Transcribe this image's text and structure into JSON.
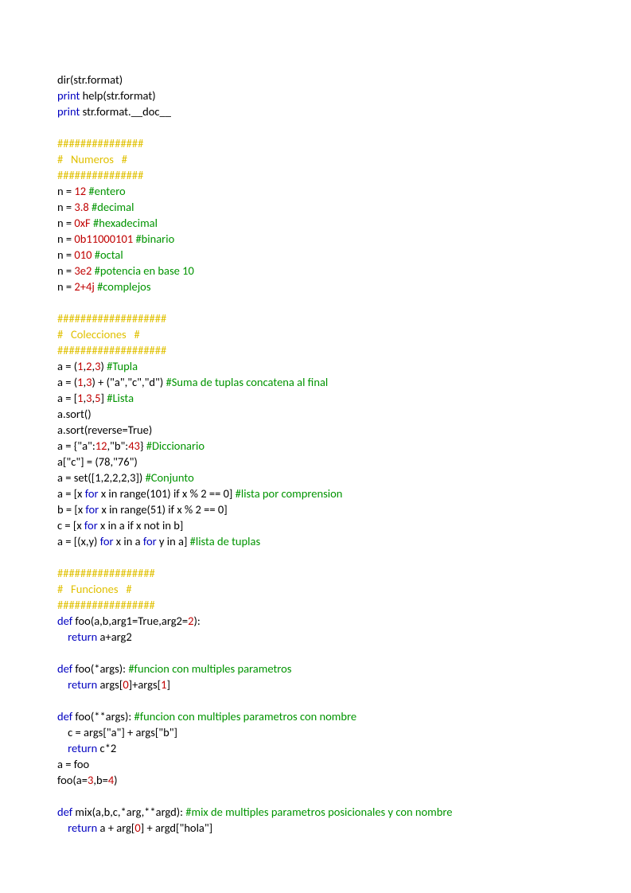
{
  "lines": [
    [
      {
        "c": "txt",
        "t": "dir(str.format)"
      }
    ],
    [
      {
        "c": "kw",
        "t": "print"
      },
      {
        "c": "txt",
        "t": " help(str.format)"
      }
    ],
    [
      {
        "c": "kw",
        "t": "print"
      },
      {
        "c": "txt",
        "t": " str.format.__doc__"
      }
    ],
    [
      {
        "c": "txt",
        "t": ""
      }
    ],
    [
      {
        "c": "hash",
        "t": "###############"
      }
    ],
    [
      {
        "c": "hash",
        "t": "#   Numeros   #"
      }
    ],
    [
      {
        "c": "hash",
        "t": "###############"
      }
    ],
    [
      {
        "c": "txt",
        "t": "n = "
      },
      {
        "c": "num",
        "t": "12"
      },
      {
        "c": "txt",
        "t": " "
      },
      {
        "c": "cmt",
        "t": "#entero"
      }
    ],
    [
      {
        "c": "txt",
        "t": "n = "
      },
      {
        "c": "num",
        "t": "3.8"
      },
      {
        "c": "txt",
        "t": " "
      },
      {
        "c": "cmt",
        "t": "#decimal"
      }
    ],
    [
      {
        "c": "txt",
        "t": "n = "
      },
      {
        "c": "num",
        "t": "0xF"
      },
      {
        "c": "txt",
        "t": " "
      },
      {
        "c": "cmt",
        "t": "#hexadecimal"
      }
    ],
    [
      {
        "c": "txt",
        "t": "n = "
      },
      {
        "c": "num",
        "t": "0b11000101"
      },
      {
        "c": "txt",
        "t": " "
      },
      {
        "c": "cmt",
        "t": "#binario"
      }
    ],
    [
      {
        "c": "txt",
        "t": "n = "
      },
      {
        "c": "num",
        "t": "010"
      },
      {
        "c": "txt",
        "t": " "
      },
      {
        "c": "cmt",
        "t": "#octal"
      }
    ],
    [
      {
        "c": "txt",
        "t": "n = "
      },
      {
        "c": "num",
        "t": "3e2"
      },
      {
        "c": "txt",
        "t": " "
      },
      {
        "c": "cmt",
        "t": "#potencia en base 10"
      }
    ],
    [
      {
        "c": "txt",
        "t": "n = "
      },
      {
        "c": "num",
        "t": "2+4j"
      },
      {
        "c": "txt",
        "t": " "
      },
      {
        "c": "cmt",
        "t": "#complejos"
      }
    ],
    [
      {
        "c": "txt",
        "t": ""
      }
    ],
    [
      {
        "c": "hash",
        "t": "###################"
      }
    ],
    [
      {
        "c": "hash",
        "t": "#   Colecciones   #"
      }
    ],
    [
      {
        "c": "hash",
        "t": "###################"
      }
    ],
    [
      {
        "c": "txt",
        "t": "a = ("
      },
      {
        "c": "num",
        "t": "1"
      },
      {
        "c": "txt",
        "t": ","
      },
      {
        "c": "num",
        "t": "2"
      },
      {
        "c": "txt",
        "t": ","
      },
      {
        "c": "num",
        "t": "3"
      },
      {
        "c": "txt",
        "t": ") "
      },
      {
        "c": "cmt",
        "t": "#Tupla"
      }
    ],
    [
      {
        "c": "txt",
        "t": "a = ("
      },
      {
        "c": "num",
        "t": "1"
      },
      {
        "c": "txt",
        "t": ","
      },
      {
        "c": "num",
        "t": "3"
      },
      {
        "c": "txt",
        "t": ") + (\"a\",\"c\",\"d\") "
      },
      {
        "c": "cmt",
        "t": "#Suma de tuplas concatena al final"
      }
    ],
    [
      {
        "c": "txt",
        "t": "a = ["
      },
      {
        "c": "num",
        "t": "1"
      },
      {
        "c": "txt",
        "t": ","
      },
      {
        "c": "num",
        "t": "3"
      },
      {
        "c": "txt",
        "t": ","
      },
      {
        "c": "num",
        "t": "5"
      },
      {
        "c": "txt",
        "t": "] "
      },
      {
        "c": "cmt",
        "t": "#Lista"
      }
    ],
    [
      {
        "c": "txt",
        "t": "a.sort()"
      }
    ],
    [
      {
        "c": "txt",
        "t": "a.sort(reverse=True)"
      }
    ],
    [
      {
        "c": "txt",
        "t": "a = {\"a\":"
      },
      {
        "c": "num",
        "t": "12"
      },
      {
        "c": "txt",
        "t": ",\"b\":"
      },
      {
        "c": "num",
        "t": "43"
      },
      {
        "c": "txt",
        "t": "} "
      },
      {
        "c": "cmt",
        "t": "#Diccionario"
      }
    ],
    [
      {
        "c": "txt",
        "t": "a[\"c\"] = (78,\"76\")"
      }
    ],
    [
      {
        "c": "txt",
        "t": "a = set([1,2,2,2,3]) "
      },
      {
        "c": "cmt",
        "t": "#Conjunto"
      }
    ],
    [
      {
        "c": "txt",
        "t": "a = [x "
      },
      {
        "c": "kw",
        "t": "for"
      },
      {
        "c": "txt",
        "t": " x in range(101) if x % 2 == 0] "
      },
      {
        "c": "cmt",
        "t": "#lista por comprension"
      }
    ],
    [
      {
        "c": "txt",
        "t": "b = [x "
      },
      {
        "c": "kw",
        "t": "for"
      },
      {
        "c": "txt",
        "t": " x in range(51) if x % 2 == 0]"
      }
    ],
    [
      {
        "c": "txt",
        "t": "c = [x "
      },
      {
        "c": "kw",
        "t": "for"
      },
      {
        "c": "txt",
        "t": " x in a if x not in b]"
      }
    ],
    [
      {
        "c": "txt",
        "t": "a = [(x,y) "
      },
      {
        "c": "kw",
        "t": "for"
      },
      {
        "c": "txt",
        "t": " x in a "
      },
      {
        "c": "kw",
        "t": "for"
      },
      {
        "c": "txt",
        "t": " y in a] "
      },
      {
        "c": "cmt",
        "t": "#lista de tuplas"
      }
    ],
    [
      {
        "c": "txt",
        "t": ""
      }
    ],
    [
      {
        "c": "hash",
        "t": "#################"
      }
    ],
    [
      {
        "c": "hash",
        "t": "#   Funciones   #"
      }
    ],
    [
      {
        "c": "hash",
        "t": "#################"
      }
    ],
    [
      {
        "c": "kw",
        "t": "def"
      },
      {
        "c": "txt",
        "t": " foo(a,b,arg1=True,arg2="
      },
      {
        "c": "num",
        "t": "2"
      },
      {
        "c": "txt",
        "t": "):"
      }
    ],
    [
      {
        "c": "txt",
        "t": "    "
      },
      {
        "c": "kw",
        "t": "return"
      },
      {
        "c": "txt",
        "t": " a+arg2"
      }
    ],
    [
      {
        "c": "txt",
        "t": ""
      }
    ],
    [
      {
        "c": "kw",
        "t": "def"
      },
      {
        "c": "txt",
        "t": " foo(*args): "
      },
      {
        "c": "cmt",
        "t": "#funcion con multiples parametros"
      }
    ],
    [
      {
        "c": "txt",
        "t": "    "
      },
      {
        "c": "kw",
        "t": "return"
      },
      {
        "c": "txt",
        "t": " args["
      },
      {
        "c": "num",
        "t": "0"
      },
      {
        "c": "txt",
        "t": "]+args["
      },
      {
        "c": "num",
        "t": "1"
      },
      {
        "c": "txt",
        "t": "]"
      }
    ],
    [
      {
        "c": "txt",
        "t": ""
      }
    ],
    [
      {
        "c": "kw",
        "t": "def"
      },
      {
        "c": "txt",
        "t": " foo(**args): "
      },
      {
        "c": "cmt",
        "t": "#funcion con multiples parametros con nombre"
      }
    ],
    [
      {
        "c": "txt",
        "t": "    c = args[\"a\"] + args[\"b\"]"
      }
    ],
    [
      {
        "c": "txt",
        "t": "    "
      },
      {
        "c": "kw",
        "t": "return"
      },
      {
        "c": "txt",
        "t": " c*2"
      }
    ],
    [
      {
        "c": "txt",
        "t": "a = foo"
      }
    ],
    [
      {
        "c": "txt",
        "t": "foo(a="
      },
      {
        "c": "num",
        "t": "3"
      },
      {
        "c": "txt",
        "t": ",b="
      },
      {
        "c": "num",
        "t": "4"
      },
      {
        "c": "txt",
        "t": ")"
      }
    ],
    [
      {
        "c": "txt",
        "t": ""
      }
    ],
    [
      {
        "c": "kw",
        "t": "def"
      },
      {
        "c": "txt",
        "t": " mix(a,b,c,*arg,**argd): "
      },
      {
        "c": "cmt",
        "t": "#mix de multiples parametros posicionales y con nombre"
      }
    ],
    [
      {
        "c": "txt",
        "t": "    "
      },
      {
        "c": "kw",
        "t": "return"
      },
      {
        "c": "txt",
        "t": " a + arg["
      },
      {
        "c": "num",
        "t": "0"
      },
      {
        "c": "txt",
        "t": "] + argd[\"hola\"]"
      }
    ]
  ]
}
